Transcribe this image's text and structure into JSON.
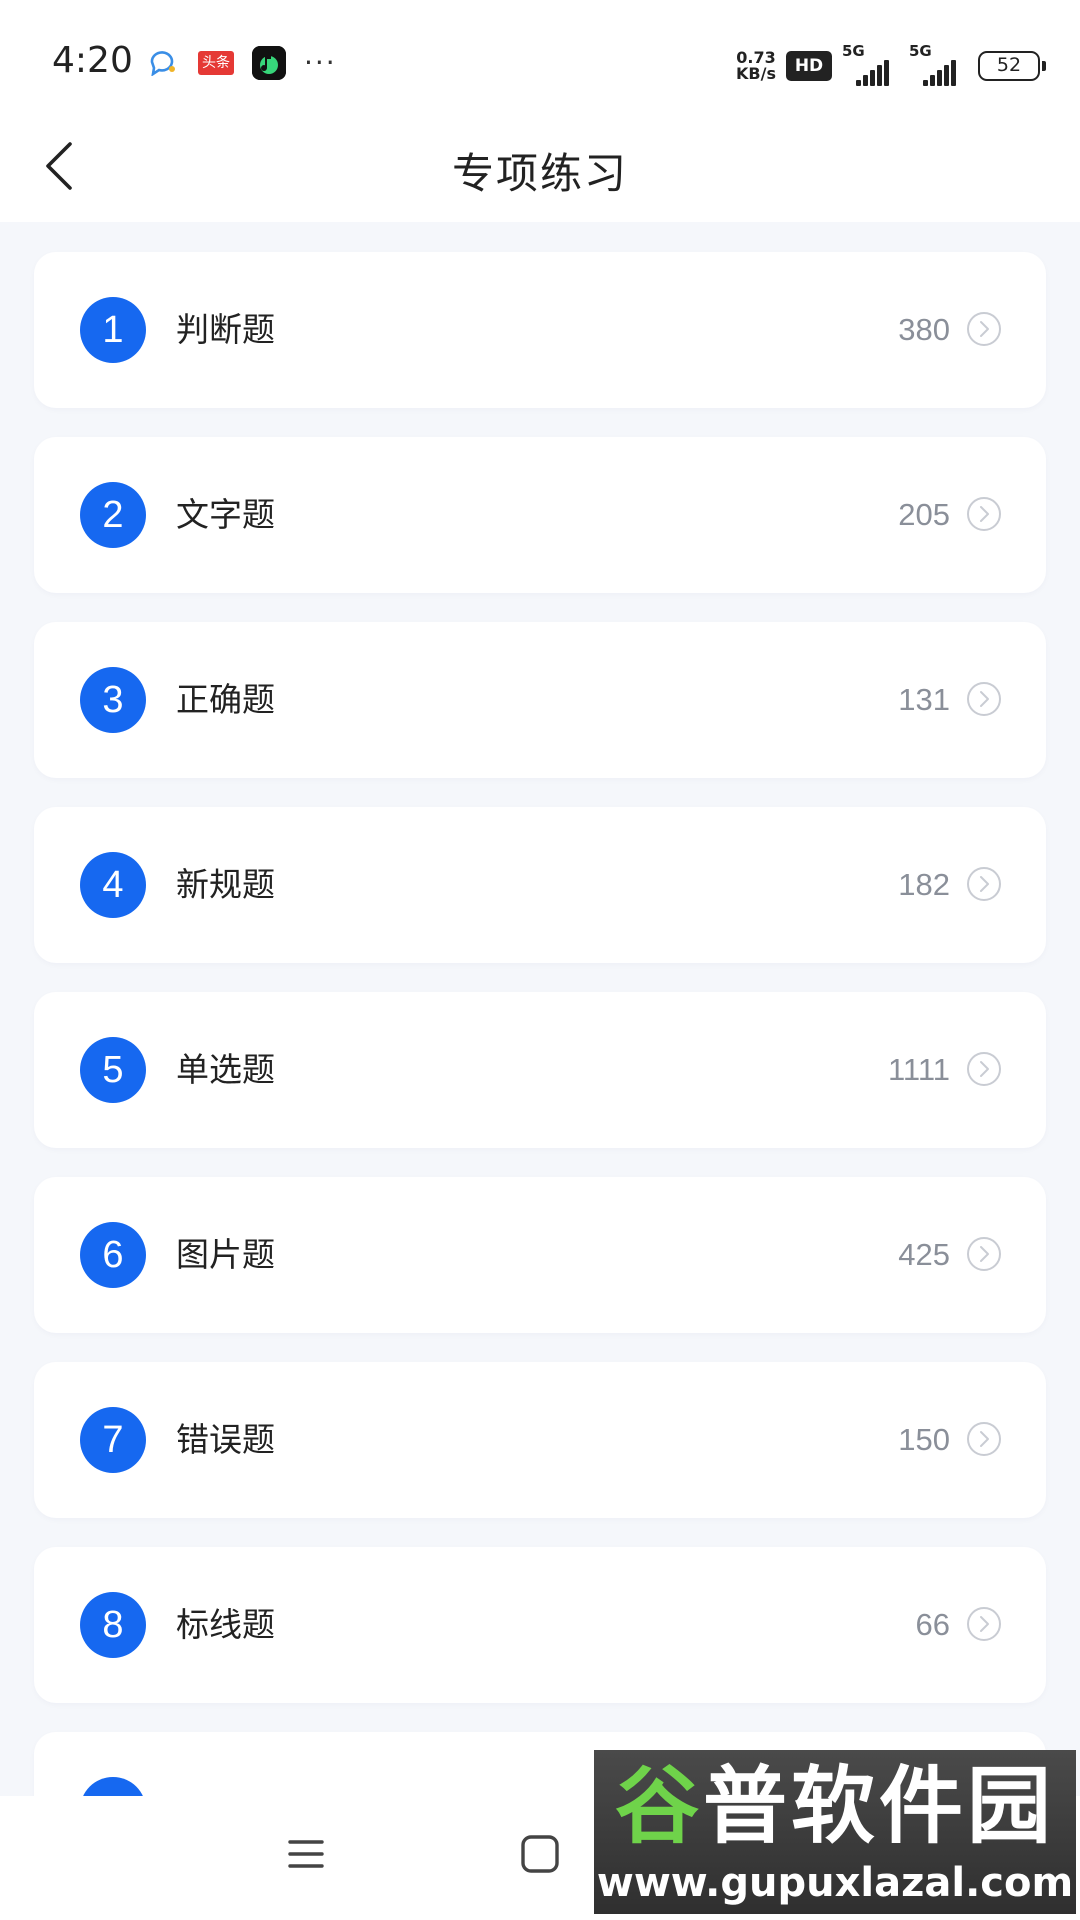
{
  "status_bar": {
    "time": "4:20",
    "toutiao_label": "头条",
    "dots": "···",
    "net_speed_value": "0.73",
    "net_speed_unit": "KB/s",
    "hd_label": "HD",
    "signal_1_label": "5G",
    "signal_2_label": "5G",
    "battery_level": "52"
  },
  "header": {
    "title": "专项练习"
  },
  "list": {
    "items": [
      {
        "number": "1",
        "label": "判断题",
        "count": "380"
      },
      {
        "number": "2",
        "label": "文字题",
        "count": "205"
      },
      {
        "number": "3",
        "label": "正确题",
        "count": "131"
      },
      {
        "number": "4",
        "label": "新规题",
        "count": "182"
      },
      {
        "number": "5",
        "label": "单选题",
        "count": "1111"
      },
      {
        "number": "6",
        "label": "图片题",
        "count": "425"
      },
      {
        "number": "7",
        "label": "错误题",
        "count": "150"
      },
      {
        "number": "8",
        "label": "标线题",
        "count": "66"
      }
    ]
  },
  "watermark": {
    "title_green": "谷",
    "title_rest": "普软件园",
    "url": "www.gupuxlazal.com"
  },
  "colors": {
    "accent": "#1668f0",
    "background": "#f5f7fb",
    "card": "#ffffff",
    "count_text": "#8a8f99"
  }
}
